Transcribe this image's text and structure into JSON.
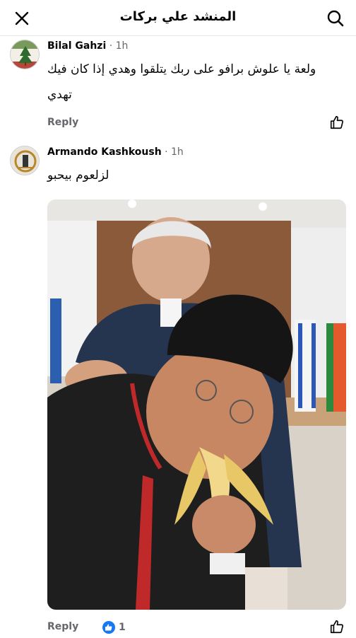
{
  "header": {
    "title": "المنشد علي بركات",
    "close_icon": "close-icon",
    "search_icon": "search-icon"
  },
  "comments": [
    {
      "author": "Bilal Gahzi",
      "time": "· 1h",
      "text": "ولعة يا علوش برافو على ربك يتلقوا وهدي إذا كان فيك تهدي",
      "reply_label": "Reply"
    },
    {
      "author": "Armando Kashkoush",
      "time": "· 1h",
      "text": "لزلعوم بيحبو",
      "reply_label": "Reply",
      "reaction_count": "1"
    }
  ],
  "colors": {
    "accent": "#1877f2",
    "secondary_text": "#65676b",
    "divider": "#e4e6eb"
  }
}
